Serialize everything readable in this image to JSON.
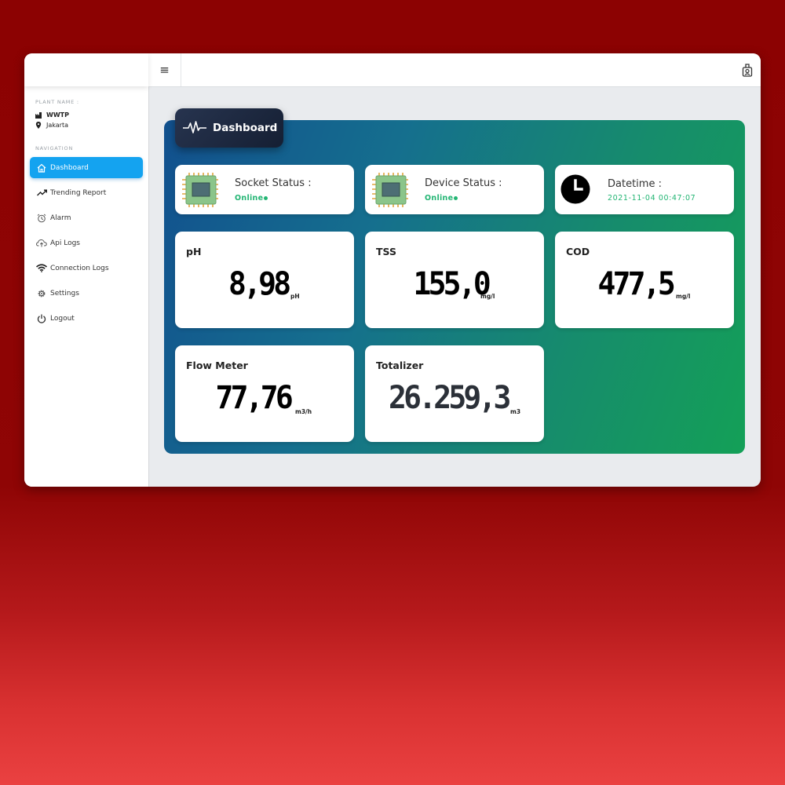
{
  "sidebar": {
    "plant_label": "PLANT NAME :",
    "plant_name": "WWTP",
    "plant_location": "Jakarta",
    "nav_label": "NAVIGATION",
    "items": [
      {
        "label": "Dashboard",
        "icon": "home-icon"
      },
      {
        "label": "Trending Report",
        "icon": "trend-icon"
      },
      {
        "label": "Alarm",
        "icon": "alarm-clock-icon"
      },
      {
        "label": "Api Logs",
        "icon": "cloud-upload-icon"
      },
      {
        "label": "Connection Logs",
        "icon": "wifi-icon"
      },
      {
        "label": "Settings",
        "icon": "gear-icon"
      },
      {
        "label": "Logout",
        "icon": "power-icon"
      }
    ]
  },
  "header": {
    "menu_icon": "hamburger-icon",
    "user_icon": "user-badge-icon"
  },
  "dashboard": {
    "title": "Dashboard",
    "socket_status": {
      "label": "Socket Status :",
      "value": "Online"
    },
    "device_status": {
      "label": "Device Status :",
      "value": "Online"
    },
    "datetime": {
      "label": "Datetime :",
      "value": "2021-11-04 00:47:07"
    },
    "ph": {
      "label": "pH",
      "value": "8,98",
      "unit": "pH"
    },
    "tss": {
      "label": "TSS",
      "value": "155,0",
      "unit": "mg/l"
    },
    "cod": {
      "label": "COD",
      "value": "477,5",
      "unit": "mg/l"
    },
    "flow": {
      "label": "Flow Meter",
      "value": "77,76",
      "unit": "m3/h"
    },
    "totalizer": {
      "label": "Totalizer",
      "value": "26.259,3",
      "unit": "m3"
    }
  },
  "colors": {
    "accent": "#14a3f0",
    "online": "#22b573",
    "panel_start": "#12508e",
    "panel_end": "#14a057"
  }
}
